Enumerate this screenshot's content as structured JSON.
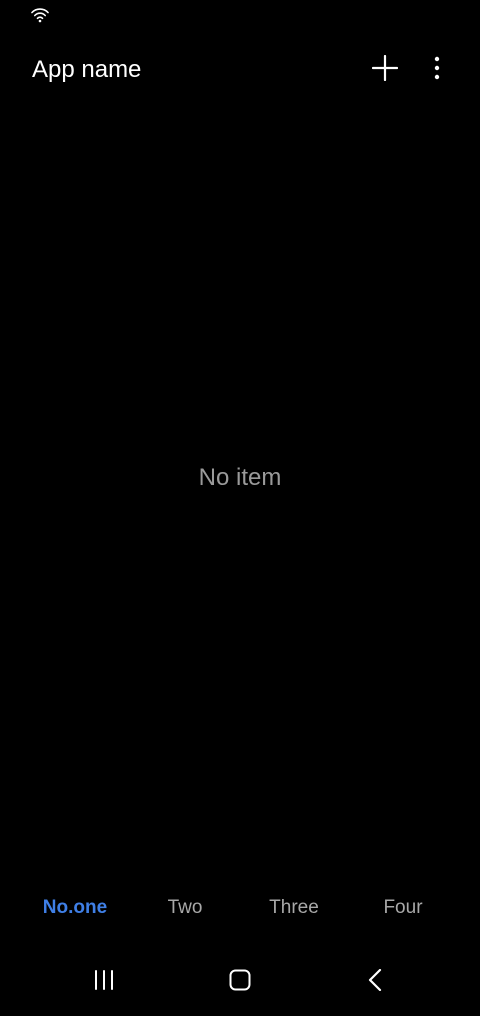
{
  "status_bar": {
    "icons": [
      "wifi-icon"
    ]
  },
  "app_bar": {
    "title": "App name",
    "actions": [
      "add-icon",
      "more-vert-icon"
    ]
  },
  "main": {
    "empty_message": "No item"
  },
  "bottom_tabs": {
    "items": [
      {
        "label": "No.one",
        "selected": true
      },
      {
        "label": "Two",
        "selected": false
      },
      {
        "label": "Three",
        "selected": false
      },
      {
        "label": "Four",
        "selected": false
      }
    ]
  },
  "nav_bar": {
    "buttons": [
      "recents-icon",
      "home-icon",
      "back-icon"
    ]
  },
  "colors": {
    "background": "#000000",
    "text_primary": "#ffffff",
    "text_secondary": "#9a9a9a",
    "accent": "#3f7fe6"
  }
}
